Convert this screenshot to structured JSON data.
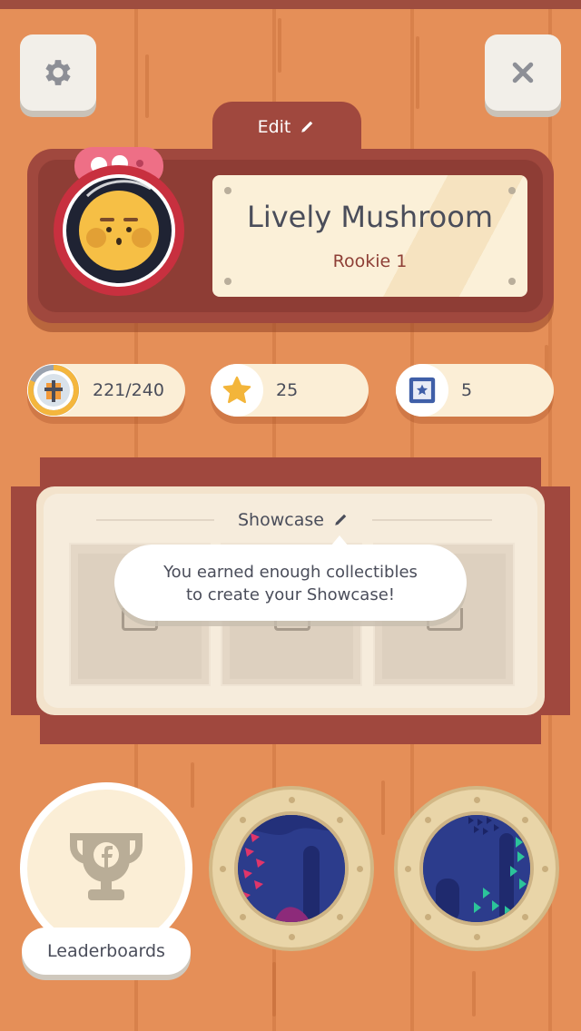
{
  "header": {
    "settings_icon": "gear-icon",
    "close_icon": "close-icon",
    "edit_label": "Edit",
    "edit_icon": "pencil-icon"
  },
  "profile": {
    "name": "Lively Mushroom",
    "rank": "Rookie 1",
    "avatar": "yellow-face-in-porthole-avatar"
  },
  "stats": [
    {
      "icon": "collectibles-progress-icon",
      "value": "221/240"
    },
    {
      "icon": "star-icon",
      "value": "25"
    },
    {
      "icon": "picture-frame-icon",
      "value": "5"
    }
  ],
  "showcase": {
    "title": "Showcase",
    "title_icon": "pencil-icon",
    "tooltip_line1": "You earned enough collectibles",
    "tooltip_line2": "to create your Showcase!"
  },
  "bottom": {
    "leaderboards_label": "Leaderboards",
    "leaderboards_icon": "trophy-facebook-icon",
    "porthole_icons": [
      "porthole-coral-scene",
      "porthole-kelp-scene"
    ]
  },
  "colors": {
    "background": "#e58f58",
    "board": "#a0483e",
    "plate": "#fbf0d8",
    "text": "#4a4d5a",
    "accent": "#e9b93a"
  }
}
